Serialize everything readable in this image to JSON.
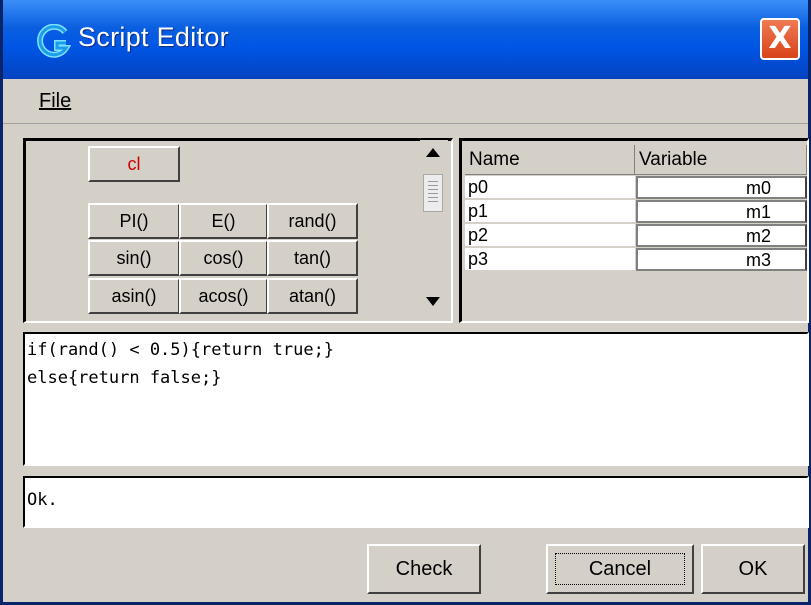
{
  "window": {
    "title": "Script Editor",
    "close_label": "X",
    "icon": "g-app-icon"
  },
  "menu": {
    "file_label": "File"
  },
  "function_buttons": {
    "clear": "cl",
    "clear_color": "#cc0000",
    "rows": [
      [
        "PI()",
        "E()",
        "rand()"
      ],
      [
        "sin()",
        "cos()",
        "tan()"
      ],
      [
        "asin()",
        "acos()",
        "atan()"
      ]
    ]
  },
  "variables_table": {
    "headers": {
      "name": "Name",
      "variable": "Variable"
    },
    "rows": [
      {
        "name": "p0",
        "variable": "m0"
      },
      {
        "name": "p1",
        "variable": "m1"
      },
      {
        "name": "p2",
        "variable": "m2"
      },
      {
        "name": "p3",
        "variable": "m3"
      }
    ]
  },
  "editor": {
    "lines": [
      "if(rand() < 0.5){return true;}",
      "else{return false;}"
    ]
  },
  "status": {
    "text": "Ok."
  },
  "actions": {
    "check": "Check",
    "cancel": "Cancel",
    "ok": "OK"
  },
  "colors": {
    "titlebar": "#0055e5",
    "background": "#d4d0c8",
    "close": "#d8431a"
  }
}
